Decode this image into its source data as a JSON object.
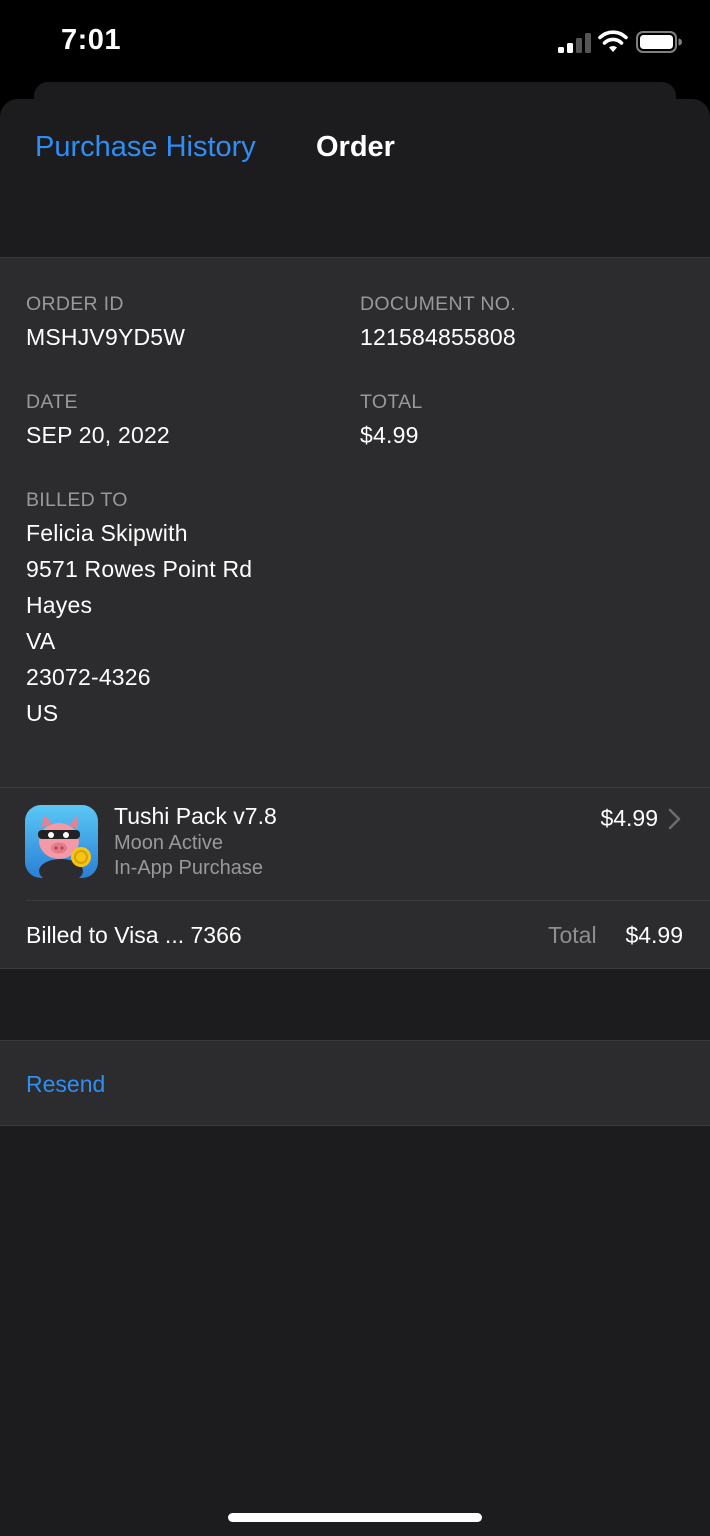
{
  "status_bar": {
    "time": "7:01",
    "icons": [
      "cellular-signal-icon",
      "wifi-icon",
      "battery-icon"
    ]
  },
  "nav": {
    "back_label": "Purchase History",
    "title": "Order"
  },
  "order": {
    "order_id_label": "ORDER ID",
    "order_id": "MSHJV9YD5W",
    "document_label": "DOCUMENT NO.",
    "document_no": "121584855808",
    "date_label": "DATE",
    "date": "SEP 20, 2022",
    "total_label": "TOTAL",
    "total": "$4.99",
    "billed_to_label": "BILLED TO",
    "billed_to": [
      "Felicia Skipwith",
      "9571 Rowes Point Rd",
      "Hayes",
      "VA",
      "23072-4326",
      "US"
    ]
  },
  "item": {
    "icon": "coin-master-pig-icon",
    "name": "Tushi Pack v7.8",
    "developer": "Moon Active",
    "type": "In-App Purchase",
    "price": "$4.99"
  },
  "payment": {
    "billed_to": "Billed to Visa ... 7366",
    "total_label": "Total",
    "total": "$4.99"
  },
  "actions": {
    "resend_label": "Resend"
  },
  "colors": {
    "accent": "#2f8ef4",
    "background": "#1c1c1e",
    "section": "#2c2c2e",
    "secondary_text": "#98989d"
  }
}
